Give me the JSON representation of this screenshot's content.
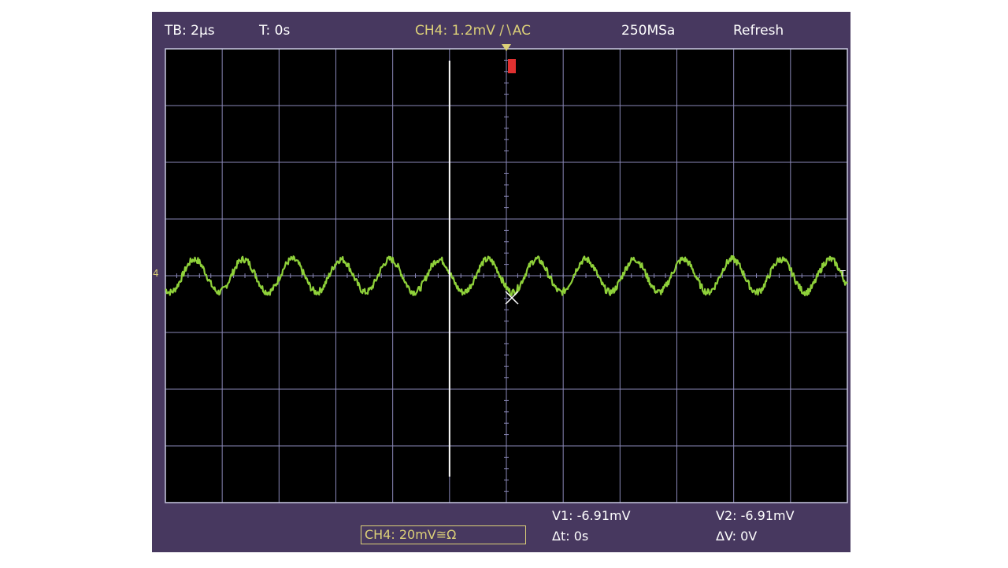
{
  "header": {
    "timebase": "TB: 2µs",
    "trigger_time": "T: 0s",
    "channel_trigger": "CH4: 1.2mV ∕∖AC",
    "sample_rate": "250MSa",
    "mode": "Refresh"
  },
  "footer": {
    "channel_scale": "CH4: 20mV≅Ω",
    "v1": "V1: -6.91mV",
    "v2": "V2: -6.91mV",
    "delta_t": "Δt: 0s",
    "delta_v": "ΔV: 0V"
  },
  "markers": {
    "channel_ground": "4",
    "trigger_position": "T"
  },
  "colors": {
    "frame": "#47385f",
    "screen": "#000000",
    "grid": "#8a88b8",
    "trace": "#8fd13a",
    "channel_text": "#dcd078",
    "cursor": "#ffffff",
    "trigger_marker": "#e03030"
  },
  "chart_data": {
    "type": "line",
    "x_unit": "µs",
    "y_unit": "mV",
    "xlim": [
      -10,
      14
    ],
    "ylim": [
      -80,
      80
    ],
    "x_divisions": 12,
    "y_divisions": 8,
    "grid": true,
    "series": [
      {
        "waveform": "sine",
        "amplitude": 5.8,
        "offset": 0,
        "period": 1.72,
        "phase": -0.8,
        "noise": 1.2
      }
    ],
    "cursor_x": 0
  }
}
